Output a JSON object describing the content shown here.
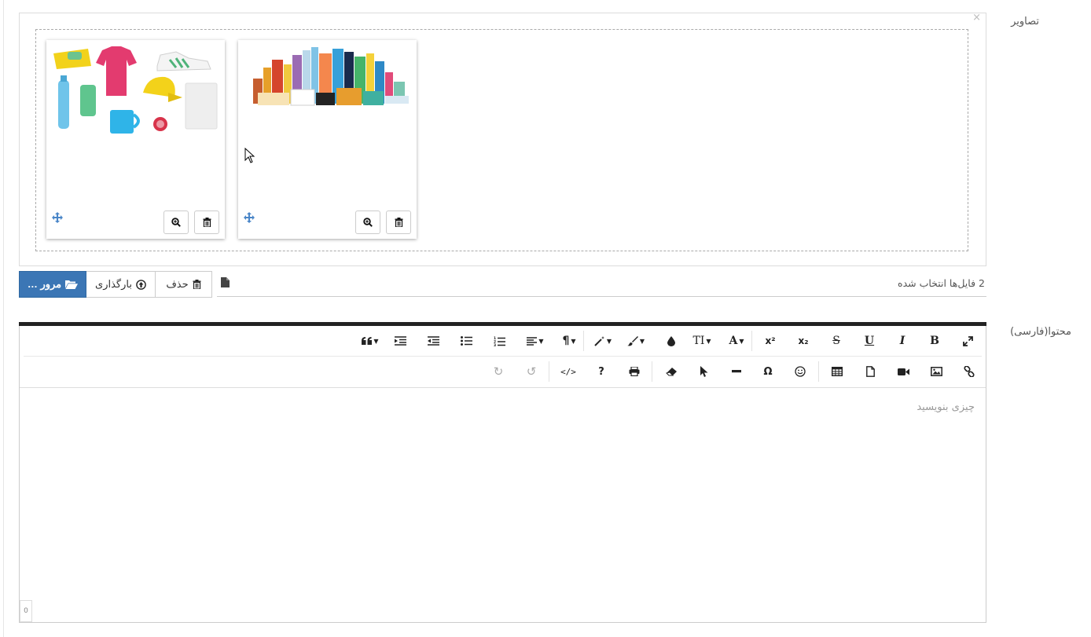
{
  "labels": {
    "images": "تصاویر",
    "content": "محتوا(فارسی)"
  },
  "preview": {
    "close_glyph": "×",
    "thumbnails": [
      {
        "image": "promo-products-collage"
      },
      {
        "image": "grocery-cosmetics-collage"
      }
    ]
  },
  "file_input": {
    "caption": "2 فایل‌ها انتخاب شده",
    "remove_label": "حذف",
    "upload_label": "بارگذاری",
    "browse_label": "مرور …"
  },
  "editor": {
    "placeholder": "چیزی بنویسید",
    "counter": "0",
    "row1": [
      {
        "name": "fullscreen",
        "glyph": "⤢"
      },
      {
        "name": "bold",
        "glyph": "B"
      },
      {
        "name": "italic",
        "glyph": "I"
      },
      {
        "name": "underline",
        "glyph": "U"
      },
      {
        "name": "strikethrough",
        "glyph": "S"
      },
      {
        "name": "subscript",
        "glyph": "x₂"
      },
      {
        "name": "superscript",
        "glyph": "x²"
      },
      {
        "name": "font-family",
        "glyph": "A"
      },
      {
        "name": "font-size",
        "glyph": "TI"
      },
      {
        "name": "color",
        "glyph": "●"
      },
      {
        "name": "paint-brush",
        "glyph": "🖌"
      },
      {
        "name": "magic-style",
        "glyph": "✦"
      },
      {
        "name": "paragraph-format",
        "glyph": "¶"
      },
      {
        "name": "align",
        "glyph": "≡"
      },
      {
        "name": "ordered-list",
        "glyph": "1≡"
      },
      {
        "name": "unordered-list",
        "glyph": "•≡"
      },
      {
        "name": "outdent",
        "glyph": "⇤"
      },
      {
        "name": "indent",
        "glyph": "⇥"
      },
      {
        "name": "quote",
        "glyph": "❝"
      }
    ],
    "row2": [
      {
        "name": "link",
        "glyph": "🔗"
      },
      {
        "name": "image",
        "glyph": "🖼"
      },
      {
        "name": "video",
        "glyph": "▶"
      },
      {
        "name": "file",
        "glyph": "📄"
      },
      {
        "name": "table",
        "glyph": "▦"
      },
      {
        "name": "emoticons",
        "glyph": "☺"
      },
      {
        "name": "special-chars",
        "glyph": "Ω"
      },
      {
        "name": "horizontal-line",
        "glyph": "—"
      },
      {
        "name": "select-all",
        "glyph": "➤"
      },
      {
        "name": "clear-formatting",
        "glyph": "⌫"
      },
      {
        "name": "print",
        "glyph": "⎙"
      },
      {
        "name": "help",
        "glyph": "?"
      },
      {
        "name": "html-view",
        "glyph": "</>"
      },
      {
        "name": "undo",
        "glyph": "↺"
      },
      {
        "name": "redo",
        "glyph": "↻"
      }
    ]
  },
  "colors": {
    "browse_button": "#3b76b5",
    "move_icon": "#4a86c8",
    "editor_topbar": "#222222"
  }
}
